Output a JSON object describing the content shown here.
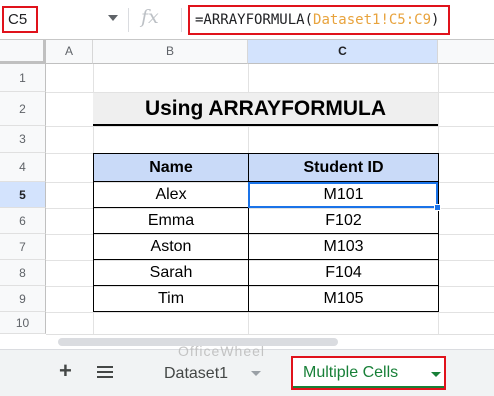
{
  "formula_bar": {
    "name_box": "C5",
    "fx_label": "fx",
    "formula_prefix": "=ARRAYFORMULA(",
    "formula_ref": "Dataset1!C5:C9",
    "formula_suffix": ")"
  },
  "columns": [
    "A",
    "B",
    "C"
  ],
  "rows": [
    "1",
    "2",
    "3",
    "4",
    "5",
    "6",
    "7",
    "8",
    "9",
    "10"
  ],
  "title": "Using ARRAYFORMULA",
  "table": {
    "headers": [
      "Name",
      "Student ID"
    ],
    "rows": [
      [
        "Alex",
        "M101"
      ],
      [
        "Emma",
        "F102"
      ],
      [
        "Aston",
        "M103"
      ],
      [
        "Sarah",
        "F104"
      ],
      [
        "Tim",
        "M105"
      ]
    ]
  },
  "sheet_tabs": {
    "add_label": "+",
    "tabs": [
      "Dataset1",
      "Multiple Cells"
    ],
    "active": "Multiple Cells"
  },
  "watermark": "OfficeWheel",
  "colors": {
    "highlight": "#e0121b",
    "header_fill": "#c9daf8",
    "selection": "#1a73e8",
    "active_tab": "#188038"
  }
}
